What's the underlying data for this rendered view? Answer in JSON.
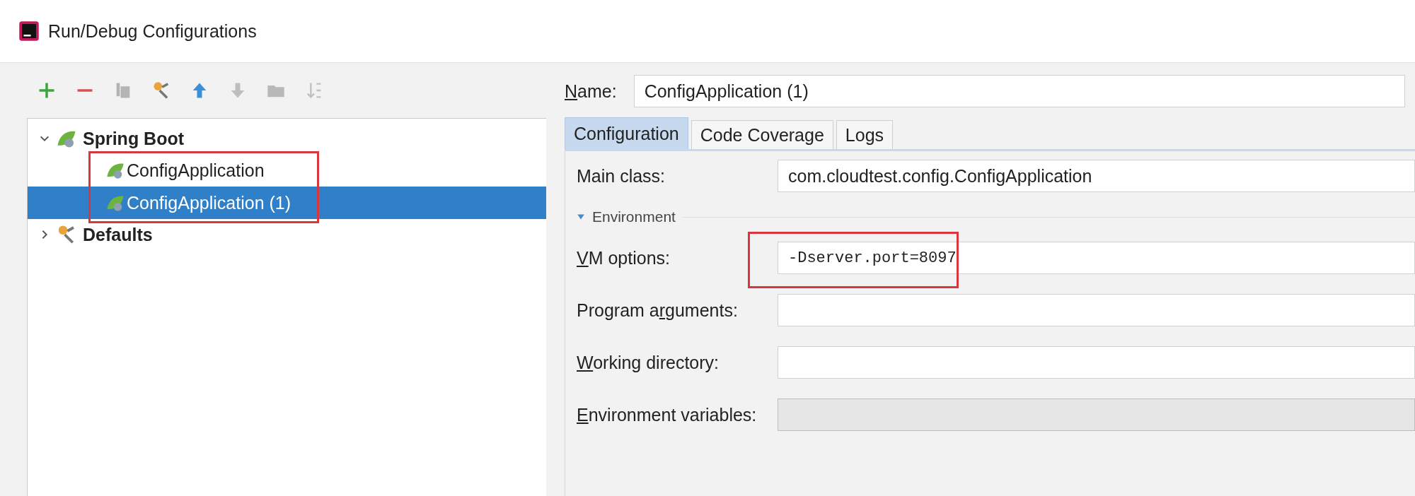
{
  "window": {
    "title": "Run/Debug Configurations"
  },
  "toolbar": [
    {
      "kind": "add",
      "disabled": false
    },
    {
      "kind": "remove",
      "disabled": false
    },
    {
      "kind": "copy",
      "disabled": true
    },
    {
      "kind": "edit",
      "disabled": false
    },
    {
      "kind": "up",
      "disabled": false
    },
    {
      "kind": "down",
      "disabled": true
    },
    {
      "kind": "folder",
      "disabled": true
    },
    {
      "kind": "sort",
      "disabled": true
    }
  ],
  "tree": [
    {
      "label": "Spring Boot",
      "kind": "spring",
      "expanded": true,
      "annotated_children": true,
      "children": [
        {
          "label": "ConfigApplication",
          "kind": "app",
          "selected": false
        },
        {
          "label": "ConfigApplication (1)",
          "kind": "app",
          "selected": true
        }
      ]
    },
    {
      "label": "Defaults",
      "kind": "defaults",
      "expanded": false
    }
  ],
  "name_field": {
    "label": {
      "key": "N",
      "post": "ame:"
    },
    "value": "ConfigApplication (1)"
  },
  "tabs": [
    {
      "label": "Configuration",
      "selected": true
    },
    {
      "label": "Code Coverage",
      "selected": false
    },
    {
      "label": "Logs",
      "selected": false
    }
  ],
  "main_class": {
    "label": {
      "pre": "Main class:"
    },
    "value": "com.cloudtest.config.ConfigApplication"
  },
  "section": {
    "label": "Environment",
    "expanded": true
  },
  "env_fields": [
    {
      "label": {
        "key": "V",
        "post": "M options:"
      },
      "value": "-Dserver.port=8097",
      "mono": true,
      "disabled": false,
      "annotated": true
    },
    {
      "label": {
        "pre": "Program a",
        "key": "r",
        "post": "guments:"
      },
      "disabled": false
    },
    {
      "label": {
        "key": "W",
        "post": "orking directory:"
      },
      "disabled": false
    },
    {
      "label": {
        "key": "E",
        "post": "nvironment variables:"
      },
      "disabled": true
    }
  ]
}
